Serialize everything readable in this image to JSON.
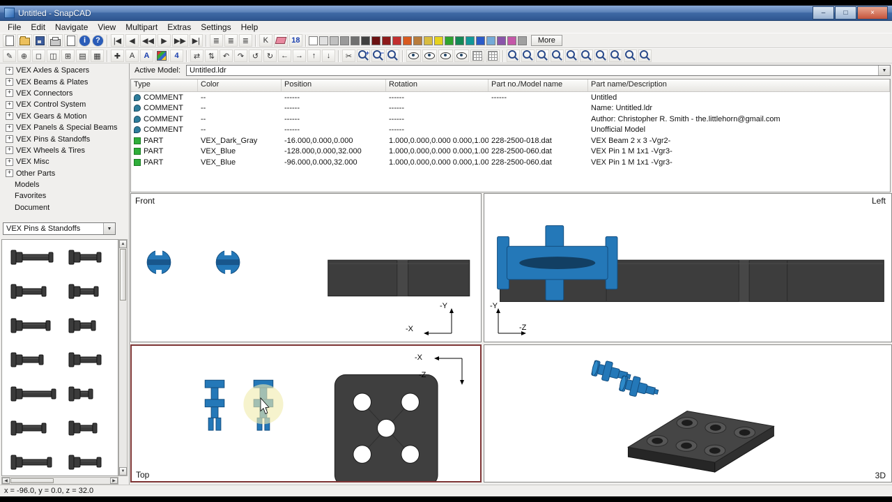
{
  "window": {
    "title": "Untitled - SnapCAD",
    "controls": {
      "minimize": "–",
      "maximize": "□",
      "close": "×"
    }
  },
  "menu": {
    "items": [
      "File",
      "Edit",
      "Navigate",
      "View",
      "Multipart",
      "Extras",
      "Settings",
      "Help"
    ]
  },
  "toolbar_top": {
    "buttons": [
      {
        "name": "new-file-icon",
        "shape": "page"
      },
      {
        "name": "open-file-icon",
        "shape": "folder"
      },
      {
        "name": "save-file-icon",
        "shape": "disk"
      },
      {
        "name": "print-icon",
        "shape": "print"
      },
      {
        "name": "print-preview-icon",
        "shape": "page"
      },
      {
        "name": "info-icon",
        "glyph": "i",
        "cls": "blue-round"
      },
      {
        "name": "help-icon",
        "glyph": "?",
        "cls": "blue-round"
      },
      {
        "sep": true
      },
      {
        "name": "first-step-icon",
        "glyph": "|◀"
      },
      {
        "name": "prev-step-icon",
        "glyph": "◀"
      },
      {
        "name": "rewind-steps-icon",
        "glyph": "◀◀"
      },
      {
        "name": "next-step-icon",
        "glyph": "▶"
      },
      {
        "name": "forward-steps-icon",
        "glyph": "▶▶"
      },
      {
        "name": "last-step-icon",
        "glyph": "▶|"
      },
      {
        "sep": true
      },
      {
        "name": "parts-list-icon",
        "glyph": "≣"
      },
      {
        "name": "step-list-icon",
        "glyph": "≣"
      },
      {
        "name": "export-list-icon",
        "glyph": "≣"
      },
      {
        "sep": true
      },
      {
        "name": "cancel-icon",
        "glyph": "K"
      },
      {
        "name": "eraser-icon",
        "shape": "eraser"
      },
      {
        "name": "scale-18-icon",
        "glyph": "18",
        "cls": "blue-text"
      },
      {
        "sep": true
      }
    ],
    "palette": [
      "#ffffff",
      "#e0e0e0",
      "#c0c0c0",
      "#9a9a9a",
      "#707070",
      "#404040",
      "#6b1111",
      "#8d1a1a",
      "#c22f2f",
      "#d85a20",
      "#b87c3c",
      "#d8bc40",
      "#e6d21e",
      "#2fa32f",
      "#148855",
      "#129898",
      "#2b5bc8",
      "#74aad8",
      "#8a55aa",
      "#c457a8",
      "#a0a0a0"
    ],
    "more_label": "More"
  },
  "toolbar_second": {
    "buttons": [
      {
        "name": "edit-mode-icon",
        "glyph": "✎"
      },
      {
        "name": "view-center-icon",
        "glyph": "⊕"
      },
      {
        "name": "single-pane-icon",
        "glyph": "◻"
      },
      {
        "name": "split-pane-icon",
        "glyph": "◫"
      },
      {
        "name": "quad-pane-icon",
        "glyph": "⊞"
      },
      {
        "name": "list-pane-icon",
        "glyph": "▤"
      },
      {
        "name": "table-pane-icon",
        "glyph": "▦"
      },
      {
        "sep": true
      },
      {
        "name": "add-part-icon",
        "glyph": "✚"
      },
      {
        "name": "annotation-icon",
        "glyph": "A"
      },
      {
        "name": "annotation-color-icon",
        "glyph": "A",
        "cls": "blue-text"
      },
      {
        "name": "colors-icon",
        "shape": "swatch"
      },
      {
        "name": "group-4-icon",
        "glyph": "4",
        "cls": "blue-text"
      },
      {
        "sep": true
      },
      {
        "name": "mirror-x-icon",
        "glyph": "⇄"
      },
      {
        "name": "mirror-y-icon",
        "glyph": "⇅"
      },
      {
        "name": "rotate-left-icon",
        "glyph": "↶"
      },
      {
        "name": "rotate-right-icon",
        "glyph": "↷"
      },
      {
        "name": "rotate-ccw-icon",
        "glyph": "↺"
      },
      {
        "name": "rotate-cw-icon",
        "glyph": "↻"
      },
      {
        "name": "move-left-icon",
        "glyph": "←"
      },
      {
        "name": "move-right-icon",
        "glyph": "→"
      },
      {
        "name": "move-up-icon",
        "glyph": "↑"
      },
      {
        "name": "move-down-icon",
        "glyph": "↓"
      },
      {
        "sep": true
      },
      {
        "name": "cut-icon",
        "glyph": "✂"
      },
      {
        "name": "zoom-in-icon",
        "shape": "mag",
        "badge": "+"
      },
      {
        "name": "zoom-out-icon",
        "shape": "mag",
        "badge": "−"
      },
      {
        "name": "zoom-fit-icon",
        "shape": "mag"
      },
      {
        "sep": true
      },
      {
        "name": "show-all-icon",
        "shape": "eye"
      },
      {
        "name": "hide-selected-icon",
        "shape": "eye"
      },
      {
        "name": "show-selected-icon",
        "shape": "eye"
      },
      {
        "name": "ghost-mode-icon",
        "shape": "eye"
      },
      {
        "name": "grid-on-icon",
        "shape": "grid"
      },
      {
        "name": "grid-snap-icon",
        "shape": "grid"
      },
      {
        "sep": true
      },
      {
        "name": "viewport-zoom-1-icon",
        "shape": "mag"
      },
      {
        "name": "viewport-zoom-2-icon",
        "shape": "mag"
      },
      {
        "name": "viewport-zoom-3-icon",
        "shape": "mag"
      },
      {
        "name": "viewport-zoom-4-icon",
        "shape": "mag"
      },
      {
        "name": "viewport-zoom-5-icon",
        "shape": "mag"
      },
      {
        "name": "viewport-zoom-6-icon",
        "shape": "mag"
      },
      {
        "name": "viewport-zoom-7-icon",
        "shape": "mag"
      },
      {
        "name": "viewport-zoom-8-icon",
        "shape": "mag"
      },
      {
        "name": "viewport-zoom-9-icon",
        "shape": "mag"
      },
      {
        "name": "viewport-zoom-10-icon",
        "shape": "mag"
      }
    ]
  },
  "sidebar": {
    "tree": [
      {
        "label": "VEX Axles & Spacers",
        "plus": true
      },
      {
        "label": "VEX Beams & Plates",
        "plus": true
      },
      {
        "label": "VEX Connectors",
        "plus": true
      },
      {
        "label": "VEX Control System",
        "plus": true
      },
      {
        "label": "VEX Gears & Motion",
        "plus": true
      },
      {
        "label": "VEX Panels & Special Beams",
        "plus": true
      },
      {
        "label": "VEX Pins & Standoffs",
        "plus": true
      },
      {
        "label": "VEX Wheels & Tires",
        "plus": true
      },
      {
        "label": "VEX Misc",
        "plus": true
      },
      {
        "label": "Other Parts",
        "plus": true
      },
      {
        "label": "Models",
        "plus": false
      },
      {
        "label": "Favorites",
        "plus": false
      },
      {
        "label": "Document",
        "plus": false
      }
    ],
    "category": "VEX Pins & Standoffs",
    "parts": [
      {
        "len": 38
      },
      {
        "len": 24
      },
      {
        "len": 28
      },
      {
        "len": 20
      },
      {
        "len": 34
      },
      {
        "len": 16
      },
      {
        "len": 24
      },
      {
        "len": 24
      },
      {
        "len": 42
      },
      {
        "len": 12
      },
      {
        "len": 28
      },
      {
        "len": 18
      },
      {
        "len": 36
      },
      {
        "len": 24
      }
    ]
  },
  "active_model": {
    "label": "Active Model:",
    "value": "Untitled.ldr"
  },
  "table": {
    "columns": [
      "Type",
      "Color",
      "Position",
      "Rotation",
      "Part no./Model name",
      "Part name/Description"
    ],
    "rows": [
      {
        "kind": "comment",
        "type": "COMMENT",
        "color": "--",
        "position": "------",
        "rotation": "------",
        "part_no": "------",
        "name": "Untitled"
      },
      {
        "kind": "comment",
        "type": "COMMENT",
        "color": "--",
        "position": "------",
        "rotation": "------",
        "part_no": "",
        "name": "Name: Untitled.ldr"
      },
      {
        "kind": "comment",
        "type": "COMMENT",
        "color": "--",
        "position": "------",
        "rotation": "------",
        "part_no": "",
        "name": "Author: Christopher R. Smith - the.littlehorn@gmail.com"
      },
      {
        "kind": "comment",
        "type": "COMMENT",
        "color": "--",
        "position": "------",
        "rotation": "------",
        "part_no": "",
        "name": "Unofficial Model"
      },
      {
        "kind": "part",
        "type": "PART",
        "color": "VEX_Dark_Gray",
        "position": "-16.000,0.000,0.000",
        "rotation": "1.000,0.000,0.000 0.000,1.00...",
        "part_no": "228-2500-018.dat",
        "name": "VEX Beam 2 x 3 -Vgr2-"
      },
      {
        "kind": "part",
        "type": "PART",
        "color": "VEX_Blue",
        "position": "-128.000,0.000,32.000",
        "rotation": "1.000,0.000,0.000 0.000,1.00...",
        "part_no": "228-2500-060.dat",
        "name": "VEX Pin 1 M 1x1 -Vgr3-"
      },
      {
        "kind": "part",
        "type": "PART",
        "color": "VEX_Blue",
        "position": "-96.000,0.000,32.000",
        "rotation": "1.000,0.000,0.000 0.000,1.00...",
        "part_no": "228-2500-060.dat",
        "name": "VEX Pin 1 M 1x1 -Vgr3-"
      }
    ]
  },
  "viewports": {
    "front": {
      "label": "Front",
      "axis_v": "-Y",
      "axis_h": "-X"
    },
    "left": {
      "label": "Left",
      "axis_v": "-Y",
      "axis_h": "-Z"
    },
    "top": {
      "label": "Top",
      "axis_h": "-X",
      "axis_v": "-Z"
    },
    "three_d": {
      "label": "3D"
    }
  },
  "status": {
    "text": "x = -96.0, y = 0.0, z = 32.0"
  },
  "colors": {
    "part_blue": "#2478b8",
    "part_dark_gray": "#3d3d3d",
    "highlight_yellow": "#f0ecae",
    "active_border": "#7e3535"
  }
}
